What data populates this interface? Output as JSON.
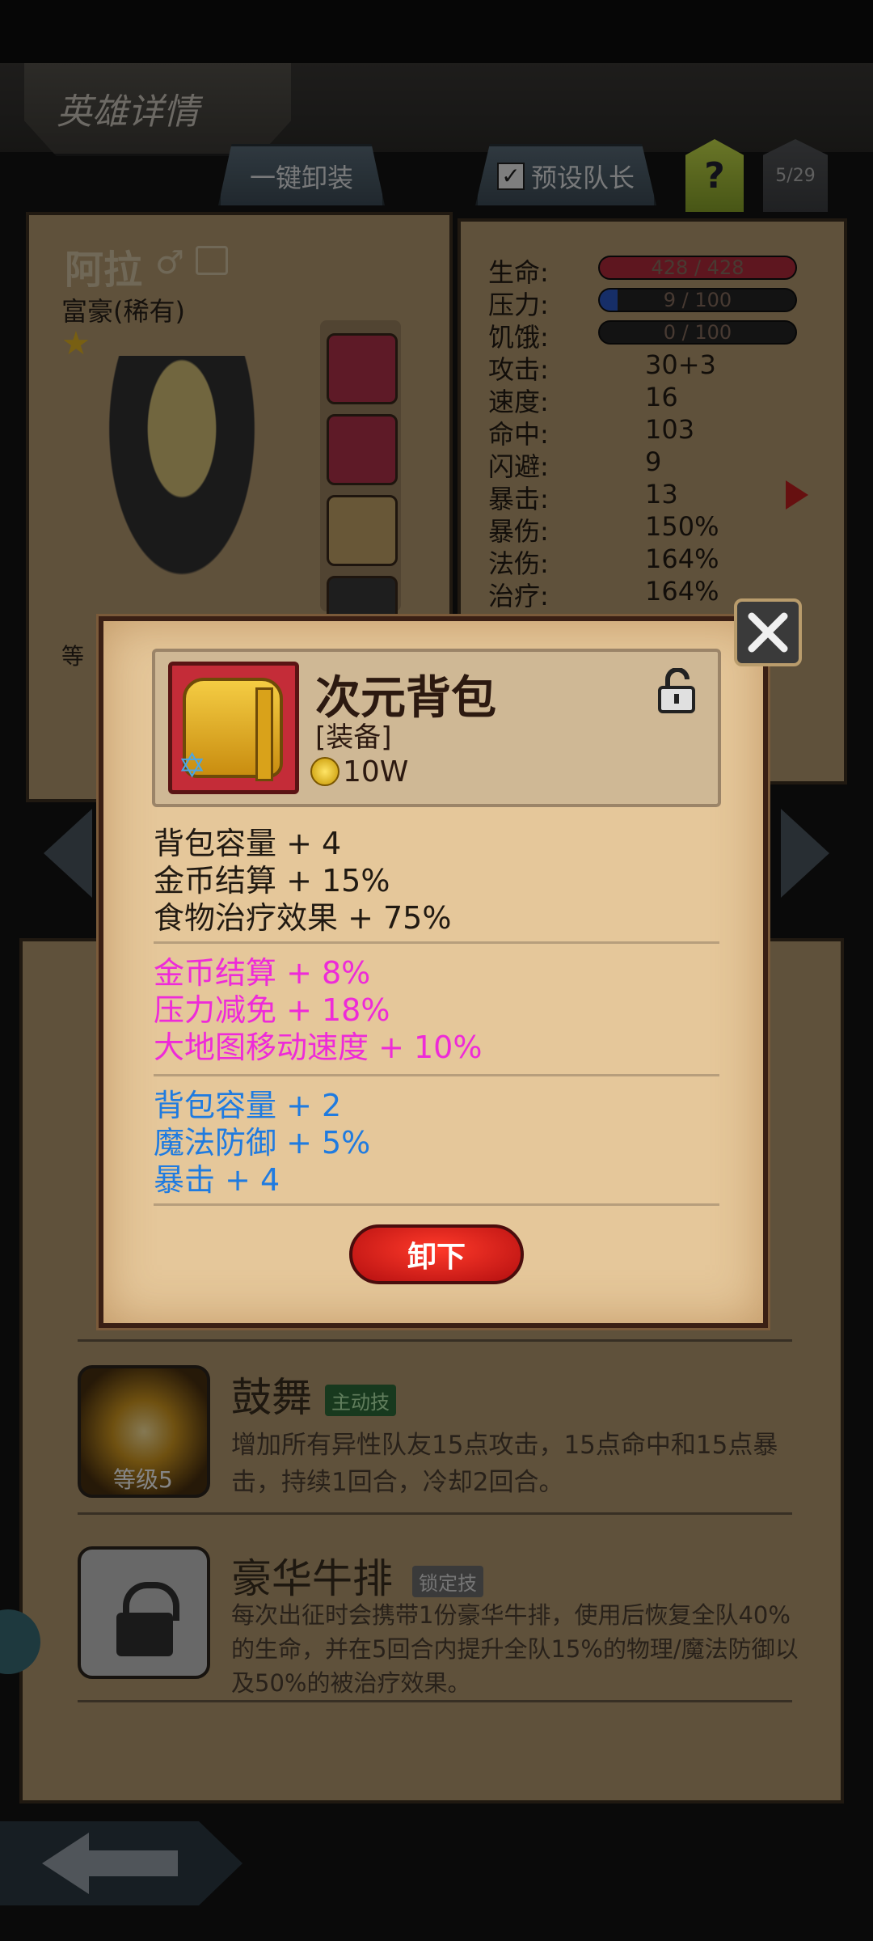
{
  "header": {
    "title": "英雄详情"
  },
  "tabs": {
    "unequip_all": "一键卸装",
    "preset_leader": "预设队长",
    "help": "?",
    "page": "5/29"
  },
  "hero": {
    "name": "阿拉",
    "class": "富豪(稀有)",
    "level_label": "等"
  },
  "stats": [
    {
      "label": "生命:",
      "value": "428 / 428",
      "type": "bar",
      "fill": 1.0,
      "color": "#b52b3c"
    },
    {
      "label": "压力:",
      "value": "9 / 100",
      "type": "bar",
      "fill": 0.09,
      "color": "#2b58c8"
    },
    {
      "label": "饥饿:",
      "value": "0 / 100",
      "type": "bar",
      "fill": 0.0,
      "color": "#666666"
    },
    {
      "label": "攻击:",
      "value": "30+3"
    },
    {
      "label": "速度:",
      "value": "16"
    },
    {
      "label": "命中:",
      "value": "103"
    },
    {
      "label": "闪避:",
      "value": "9"
    },
    {
      "label": "暴击:",
      "value": "13"
    },
    {
      "label": "暴伤:",
      "value": "150%"
    },
    {
      "label": "法伤:",
      "value": "164%"
    },
    {
      "label": "治疗:",
      "value": "164%"
    }
  ],
  "skills": [
    {
      "name": "鼓舞",
      "badge": "主动技",
      "level": "等级5",
      "desc": "增加所有异性队友15点攻击，15点命中和15点暴击，持续1回合，冷却2回合。"
    },
    {
      "name": "豪华牛排",
      "badge": "锁定技",
      "desc": "每次出征时会携带1份豪华牛排，使用后恢复全队40%的生命，并在5回合内提升全队15%的物理/魔法防御以及50%的被治疗效果。"
    }
  ],
  "item": {
    "name": "次元背包",
    "type": "[装备]",
    "price": "10W",
    "base_attrs": [
      "背包容量 + 4",
      "金币结算 + 15%",
      "食物治疗效果 + 75%"
    ],
    "pink_attrs": [
      "金币结算 + 8%",
      "压力减免 + 18%",
      "大地图移动速度 + 10%"
    ],
    "blue_attrs": [
      "背包容量 + 2",
      "魔法防御 + 5%",
      "暴击 + 4"
    ],
    "unequip_label": "卸下"
  },
  "colors": {
    "pink": "#ee2bd8",
    "blue": "#1f7be0",
    "button_red": "#d4201a"
  }
}
